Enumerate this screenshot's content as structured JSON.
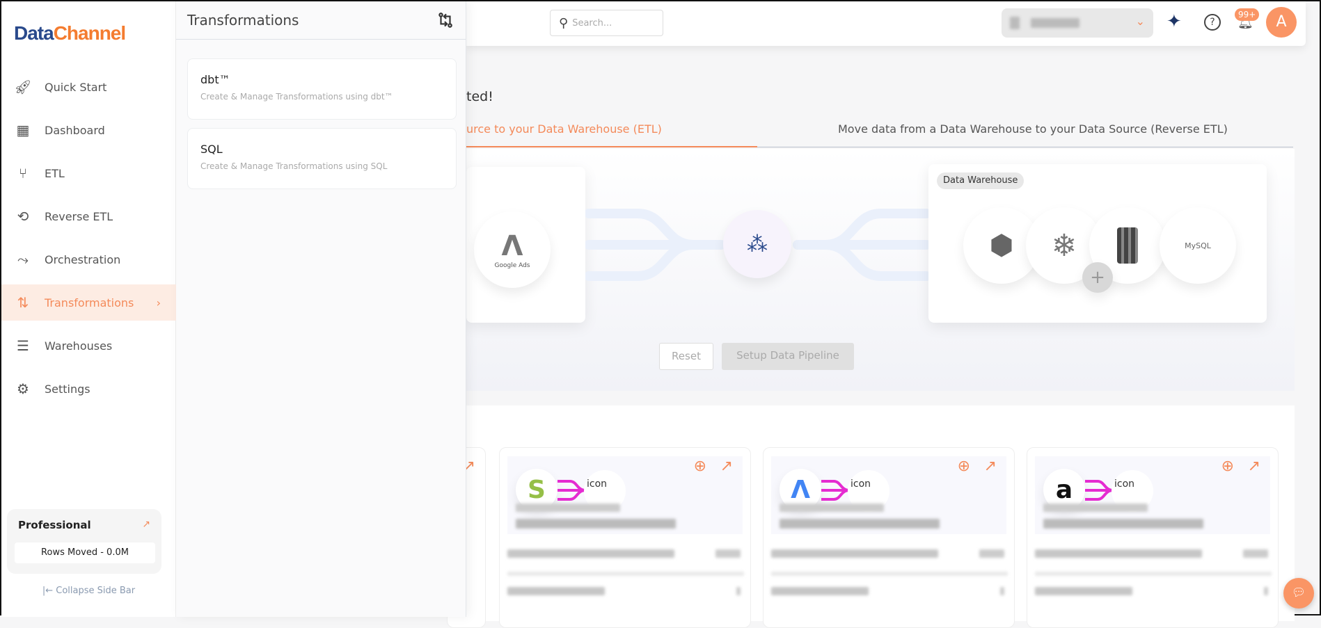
{
  "brand": {
    "logo_part1": "Data",
    "logo_part2": "Channel",
    "accent": "#f48a5a"
  },
  "sidebar": {
    "items": [
      {
        "label": "Quick Start",
        "icon": "rocket-icon"
      },
      {
        "label": "Dashboard",
        "icon": "dashboard-icon"
      },
      {
        "label": "ETL",
        "icon": "etl-icon"
      },
      {
        "label": "Reverse ETL",
        "icon": "reverse-etl-icon"
      },
      {
        "label": "Orchestration",
        "icon": "orchestration-icon"
      },
      {
        "label": "Transformations",
        "icon": "transformations-icon",
        "active": true
      },
      {
        "label": "Warehouses",
        "icon": "warehouses-icon"
      },
      {
        "label": "Settings",
        "icon": "gear-icon"
      }
    ],
    "plan": {
      "name": "Professional",
      "rows": "Rows Moved - 0.0M"
    },
    "collapse": "|← Collapse Side Bar"
  },
  "panel": {
    "title": "Transformations",
    "items": [
      {
        "name": "dbt™",
        "desc": "Create & Manage Transformations using dbt™"
      },
      {
        "name": "SQL",
        "desc": "Create & Manage Transformations using SQL"
      }
    ]
  },
  "header": {
    "search_placeholder": "Search...",
    "notifications": "99+",
    "avatar": "A"
  },
  "main": {
    "greeting": "ted!",
    "tabs": [
      {
        "label": "urce to your Data Warehouse (ETL)",
        "active": true
      },
      {
        "label": "Move data from a Data Warehouse to your Data Source (Reverse ETL)"
      }
    ],
    "source_label": "Google Ads",
    "warehouse_label": "Data Warehouse",
    "warehouse_mysql": "MySQL",
    "reset": "Reset",
    "setup": "Setup Data Pipeline",
    "card_img_alt": "icon"
  }
}
